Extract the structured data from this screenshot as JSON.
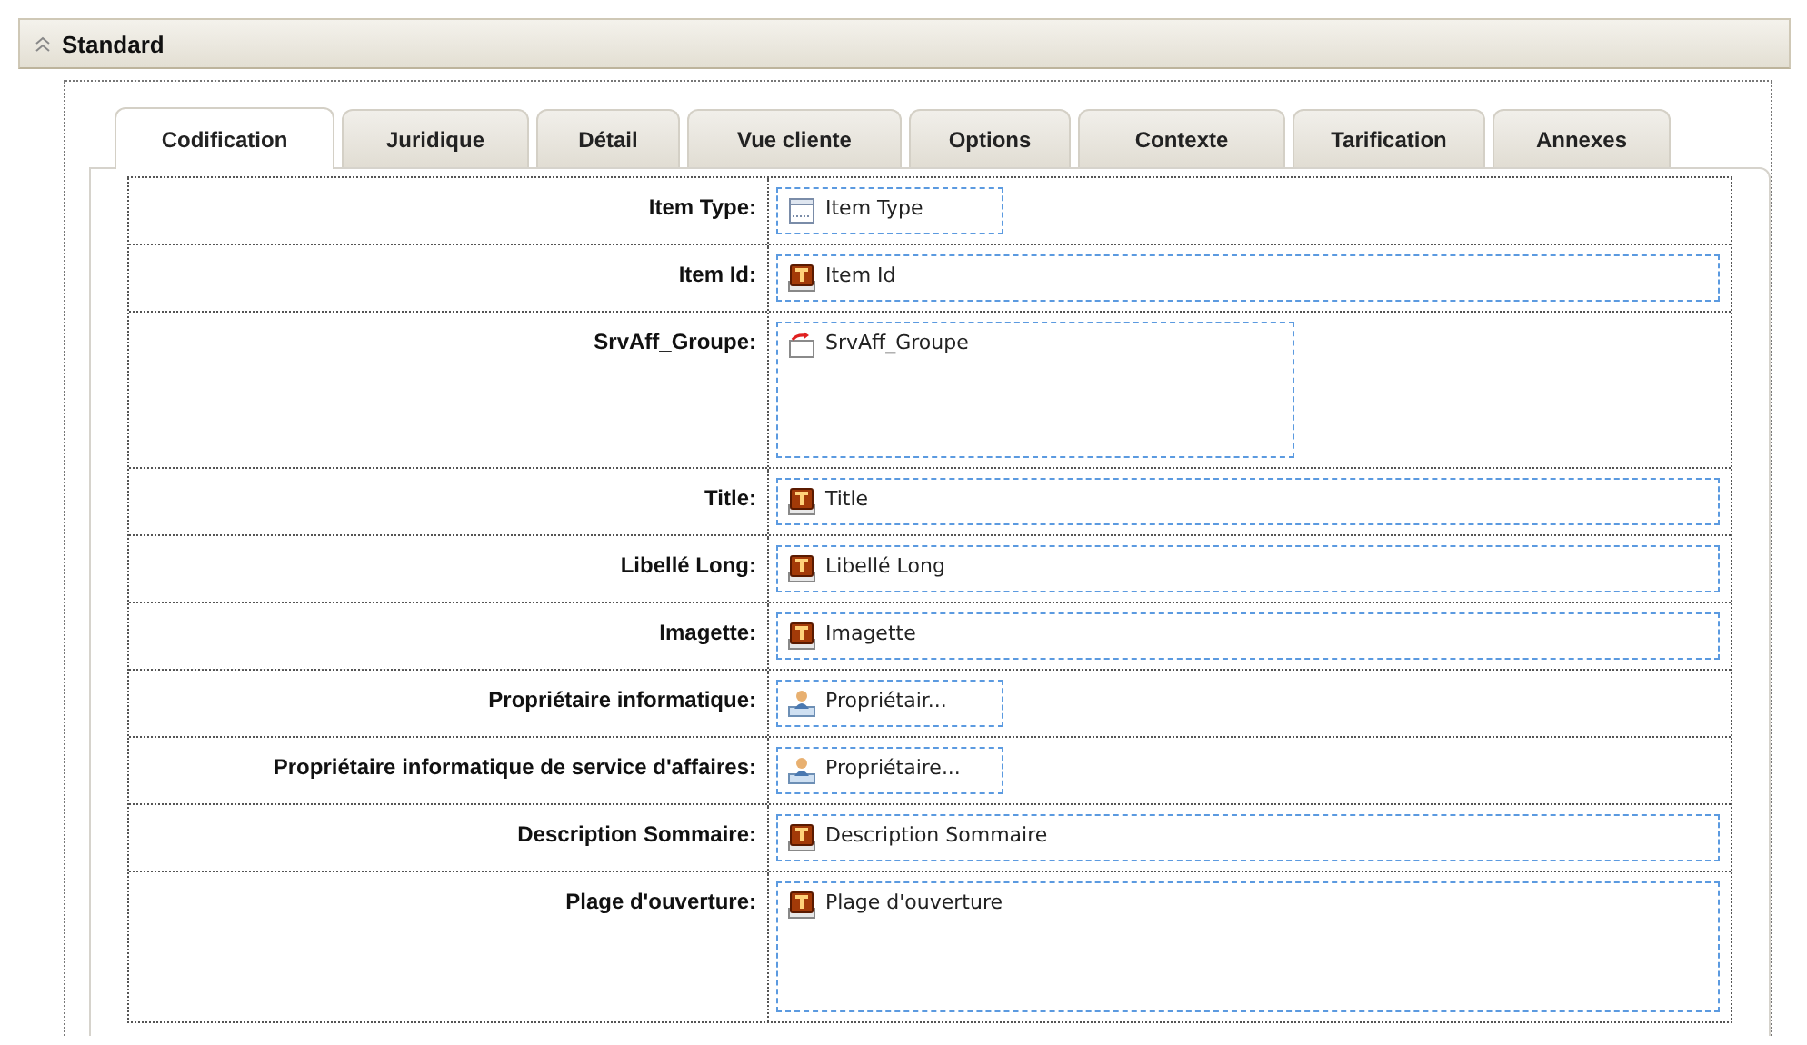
{
  "section": {
    "title": "Standard",
    "expanded": true
  },
  "tabs": [
    {
      "label": "Codification",
      "selected": true
    },
    {
      "label": "Juridique",
      "selected": false
    },
    {
      "label": "Détail",
      "selected": false
    },
    {
      "label": "Vue cliente",
      "selected": false
    },
    {
      "label": "Options",
      "selected": false
    },
    {
      "label": "Contexte",
      "selected": false
    },
    {
      "label": "Tarification",
      "selected": false
    },
    {
      "label": "Annexes",
      "selected": false
    }
  ],
  "fields": [
    {
      "label": "Item Type:",
      "value": "Item Type",
      "kind": "type",
      "wide": false,
      "multiline": false
    },
    {
      "label": "Item Id:",
      "value": "Item Id",
      "kind": "text",
      "wide": true,
      "multiline": false
    },
    {
      "label": "SrvAff_Groupe:",
      "value": "SrvAff_Groupe",
      "kind": "link",
      "wide": false,
      "multiline": true
    },
    {
      "label": "Title:",
      "value": "Title",
      "kind": "text",
      "wide": true,
      "multiline": false
    },
    {
      "label": "Libellé Long:",
      "value": "Libellé Long",
      "kind": "text",
      "wide": true,
      "multiline": false
    },
    {
      "label": "Imagette:",
      "value": "Imagette",
      "kind": "text",
      "wide": true,
      "multiline": false
    },
    {
      "label": "Propriétaire informatique:",
      "value": "Propriétair...",
      "kind": "person",
      "wide": false,
      "multiline": false
    },
    {
      "label": "Propriétaire informatique de service d'affaires:",
      "value": "Propriétaire...",
      "kind": "person",
      "wide": false,
      "multiline": false
    },
    {
      "label": "Description Sommaire:",
      "value": "Description Sommaire",
      "kind": "text",
      "wide": true,
      "multiline": false
    },
    {
      "label": "Plage d'ouverture:",
      "value": "Plage d'ouverture",
      "kind": "text",
      "wide": true,
      "multiline": true
    }
  ]
}
